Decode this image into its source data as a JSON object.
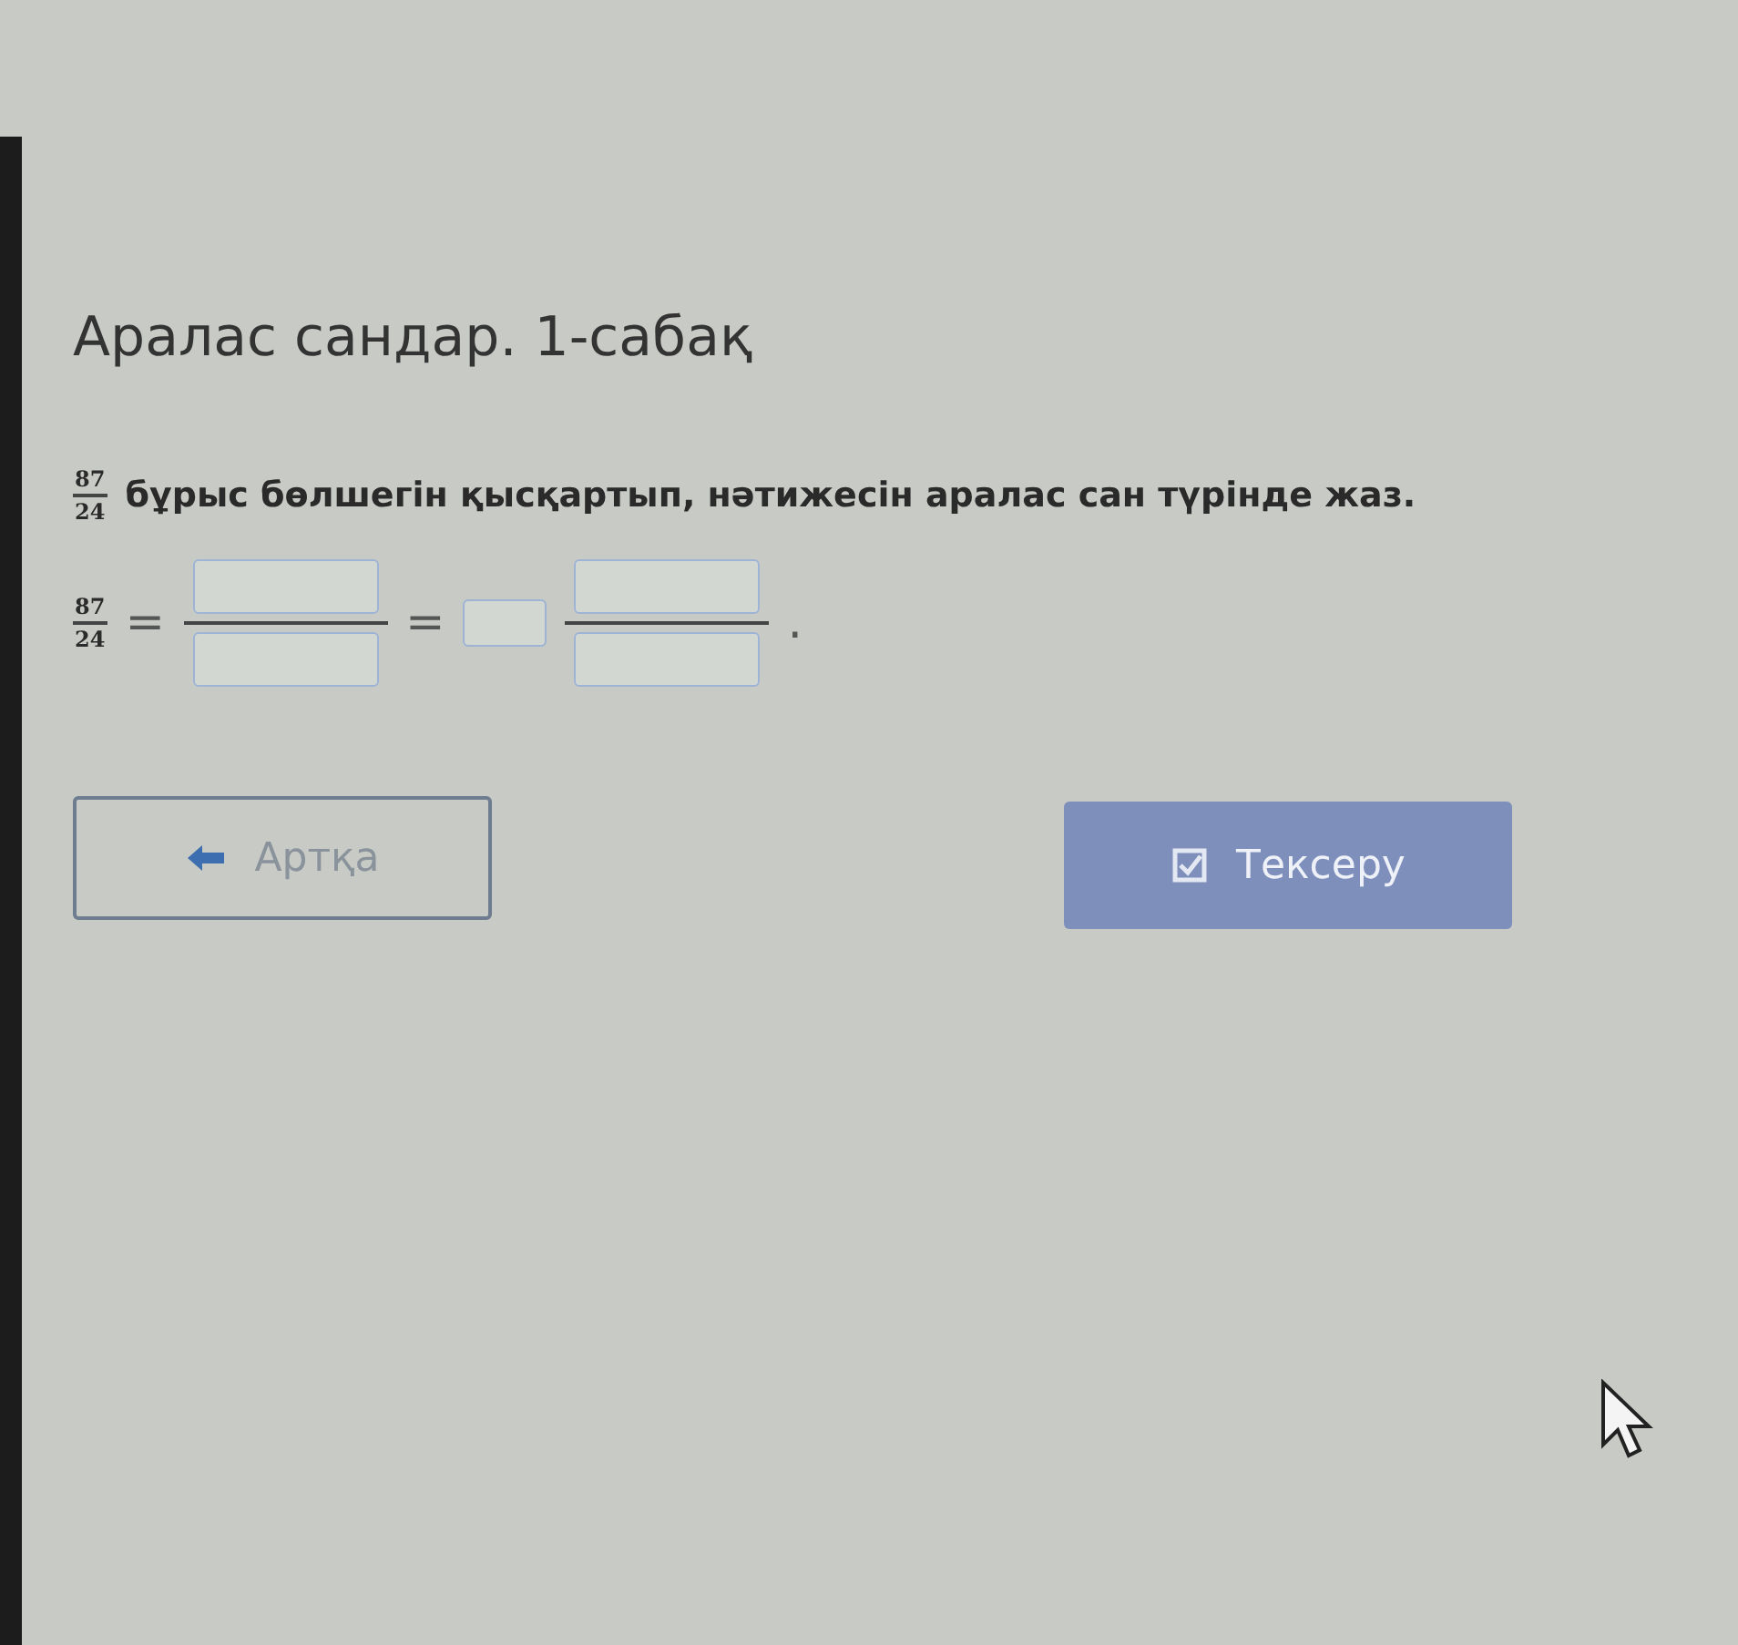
{
  "title": "Аралас сандар. 1-сабақ",
  "instruction": {
    "fraction": {
      "numerator": "87",
      "denominator": "24"
    },
    "text": "бұрыс бөлшегін қысқартып, нәтижесін аралас сан түрінде жаз."
  },
  "equation": [
    {
      "kind": "fraction",
      "numerator": "87",
      "denominator": "24"
    },
    {
      "kind": "sign",
      "text": "="
    },
    {
      "kind": "fraction_input"
    },
    {
      "kind": "sign",
      "text": "="
    },
    {
      "kind": "whole_input"
    },
    {
      "kind": "fraction_input"
    },
    {
      "kind": "sign",
      "text": "."
    }
  ],
  "buttons": [
    {
      "kind": "back",
      "label": "Артқа",
      "disabled": false
    },
    {
      "kind": "check",
      "label": "Тексеру",
      "disabled": true
    }
  ]
}
